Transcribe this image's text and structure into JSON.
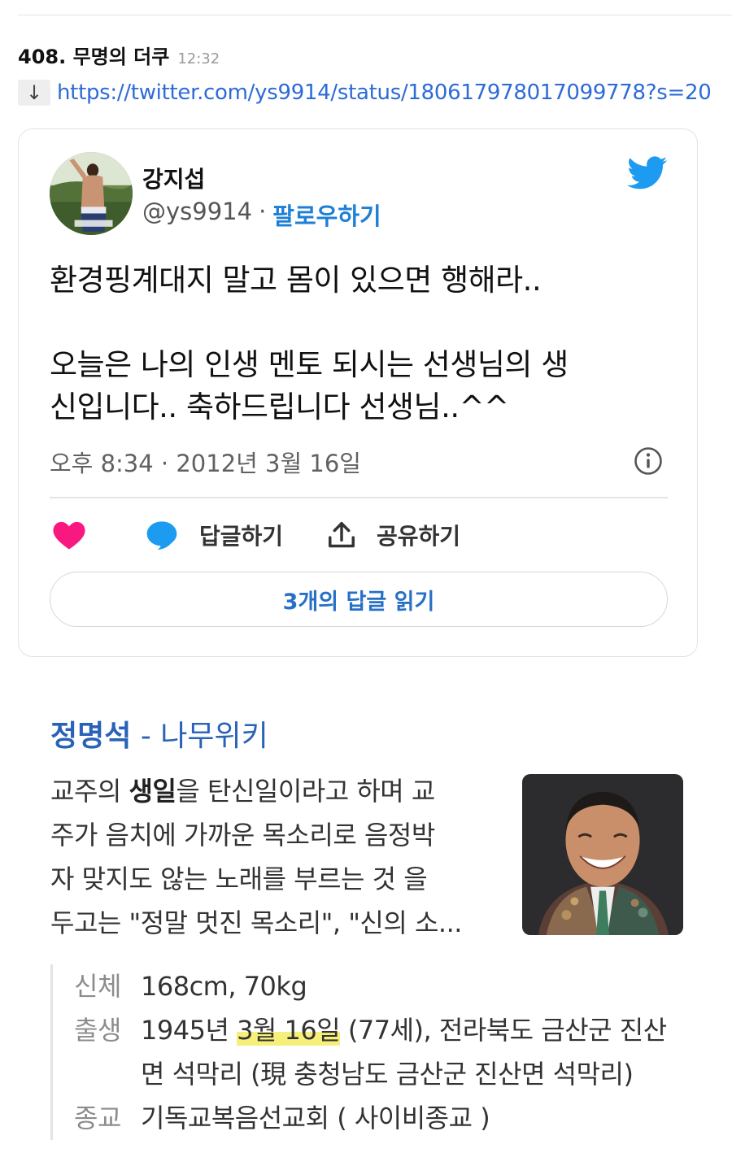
{
  "post": {
    "title": "408. 무명의 더쿠",
    "time": "12:32",
    "arrow": "↓",
    "link": "https://twitter.com/ys9914/status/180617978017099778?s=20"
  },
  "tweet": {
    "user_name": "강지섭",
    "handle": "@ys9914",
    "separator": "·",
    "follow_label": "팔로우하기",
    "lines": [
      "환경핑계대지 말고 몸이 있으면 행해라..",
      "오늘은 나의 인생 멘토 되시는 선생님의 생",
      "신입니다.. 축하드립니다 선생님..^^"
    ],
    "date": "오후 8:34 · 2012년 3월 16일",
    "reply_label": "답글하기",
    "share_label": "공유하기",
    "read_replies_label": "3개의 답글 읽기",
    "colors": {
      "link": "#1d7fd6",
      "heart": "#f91880",
      "bird": "#1d9bf0"
    }
  },
  "wiki": {
    "title_name": "정명석",
    "title_suffix": " - 나무위키",
    "snippet_line1_pre": "교주의 ",
    "snippet_line1_bold": "생일",
    "snippet_line1_post": "을 탄신일이라고 하며 교",
    "snippet_line2": "주가 음치에 가까운 목소리로 음정박",
    "snippet_line3": "자 맞지도 않는 노래를 부르는 것 을",
    "snippet_line4": "두고는 \"정말 멋진 목소리\", \"신의 소...",
    "info": {
      "body_label": "신체",
      "body_value": "168cm, 70kg",
      "birth_label": "출생",
      "birth_pre": "1945년 ",
      "birth_highlight": "3월 16일",
      "birth_post": " (77세), 전라북도 금산군 진산",
      "birth_line2": "면 석막리 (現 충청남도 금산군 진산면 석막리)",
      "religion_label": "종교",
      "religion_value": "기독교복음선교회 ( 사이비종교 )"
    }
  }
}
